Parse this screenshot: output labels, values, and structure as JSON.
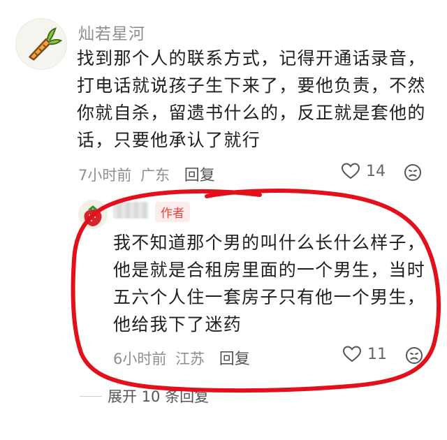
{
  "comment": {
    "username": "灿若星河",
    "avatar_icon": "carrot-icon",
    "text": "找到那个人的联系方式，记得开通话录音，打电话就说孩子生下来了，要他负责，不然你就自杀，留遗书什么的，反正就是套他的话，只要他承认了就行",
    "time": "7小时前",
    "location": "广东",
    "reply_label": "回复",
    "like_count": "14"
  },
  "reply": {
    "author_badge": "作者",
    "text": "我不知道那个男的叫什么长什么样子，他是就是合租房里面的一个男生，当时五六个人住一套房子只有他一个男生，他给我下了迷药",
    "time": "6小时前",
    "location": "江苏",
    "reply_label": "回复",
    "like_count": "11"
  },
  "expand_label": "展开 10 条回复",
  "annotation": {
    "color": "#e3101c"
  }
}
